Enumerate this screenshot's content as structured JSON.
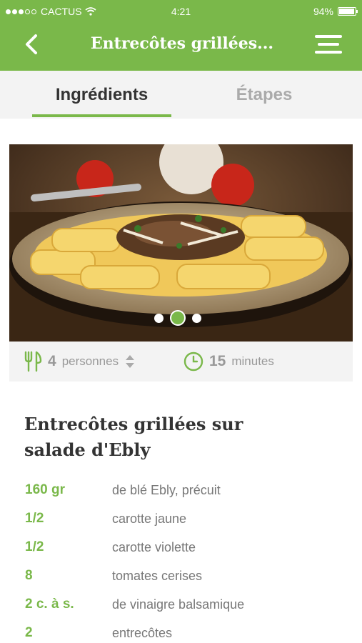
{
  "status_bar": {
    "carrier": "CACTUS",
    "time": "4:21",
    "battery": "94%",
    "battery_level": 0.94
  },
  "nav": {
    "title": "Entrecôtes grillées...",
    "back_icon": "chevron-left-icon",
    "menu_icon": "hamburger-menu-icon"
  },
  "tabs": [
    {
      "label": "Ingrédients",
      "active": true
    },
    {
      "label": "Étapes",
      "active": false
    }
  ],
  "carousel": {
    "count": 3,
    "active_index": 1
  },
  "info": {
    "servings": "4",
    "servings_label": "personnes",
    "time": "15",
    "time_label": "minutes"
  },
  "recipe": {
    "title_line1": "Entrecôtes grillées sur",
    "title_line2": "salade d'Ebly",
    "ingredients": [
      {
        "qty": "160 gr",
        "name": "de blé Ebly, précuit"
      },
      {
        "qty": "1/2",
        "name": "carotte jaune"
      },
      {
        "qty": "1/2",
        "name": "carotte violette"
      },
      {
        "qty": "8",
        "name": "tomates cerises"
      },
      {
        "qty": "2 c. à s.",
        "name": "de vinaigre balsamique"
      },
      {
        "qty": "2",
        "name": "entrecôtes"
      }
    ]
  },
  "colors": {
    "accent": "#7ab84a",
    "tab_bg": "#f3f3f3",
    "muted": "#999999"
  }
}
